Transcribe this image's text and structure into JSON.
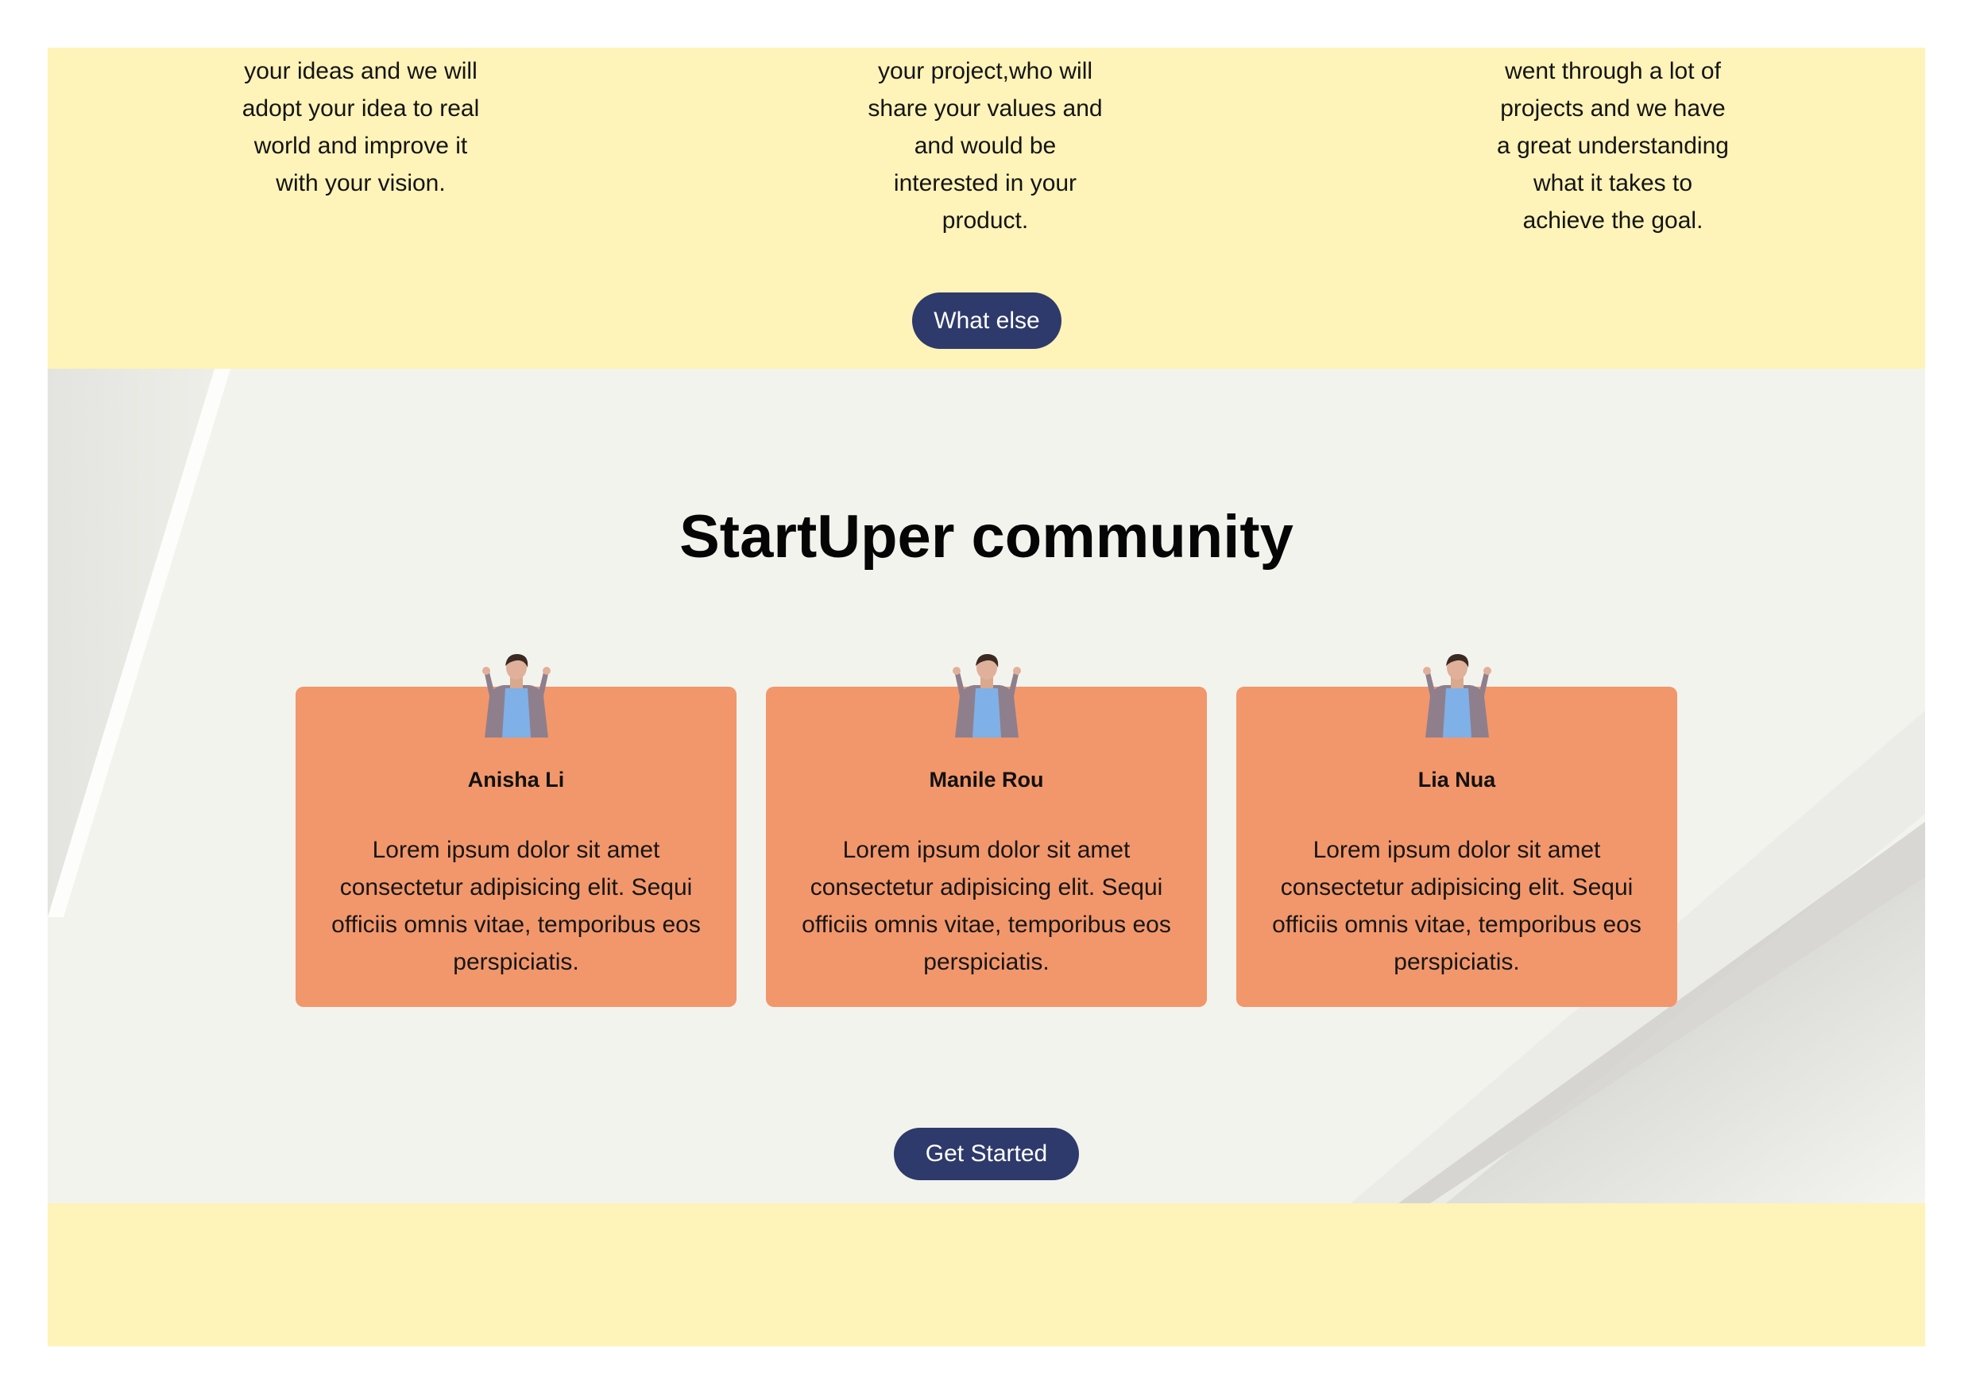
{
  "features": {
    "items": [
      {
        "text": "your ideas and we will adopt your idea to real world and improve it with your vision."
      },
      {
        "text": "your project,who will share your values and and would be interested in your product."
      },
      {
        "text": "went through a lot of projects and we have a great understanding what it takes to achieve the goal."
      }
    ],
    "button_label": "What else"
  },
  "community": {
    "title": "StartUper community",
    "members": [
      {
        "name": "Anisha Li",
        "bio": "Lorem ipsum dolor sit amet consectetur adipisicing elit. Sequi officiis omnis vitae, temporibus eos perspiciatis."
      },
      {
        "name": "Manile Rou",
        "bio": "Lorem ipsum dolor sit amet consectetur adipisicing elit. Sequi officiis omnis vitae, temporibus eos perspiciatis."
      },
      {
        "name": "Lia Nua",
        "bio": "Lorem ipsum dolor sit amet consectetur adipisicing elit. Sequi officiis omnis vitae, temporibus eos perspiciatis."
      }
    ],
    "button_label": "Get Started"
  },
  "colors": {
    "yellow_background": "#fef3b8",
    "card_orange": "#f2976b",
    "button_navy": "#2e3a6b",
    "section_background": "#f3f3ee"
  }
}
